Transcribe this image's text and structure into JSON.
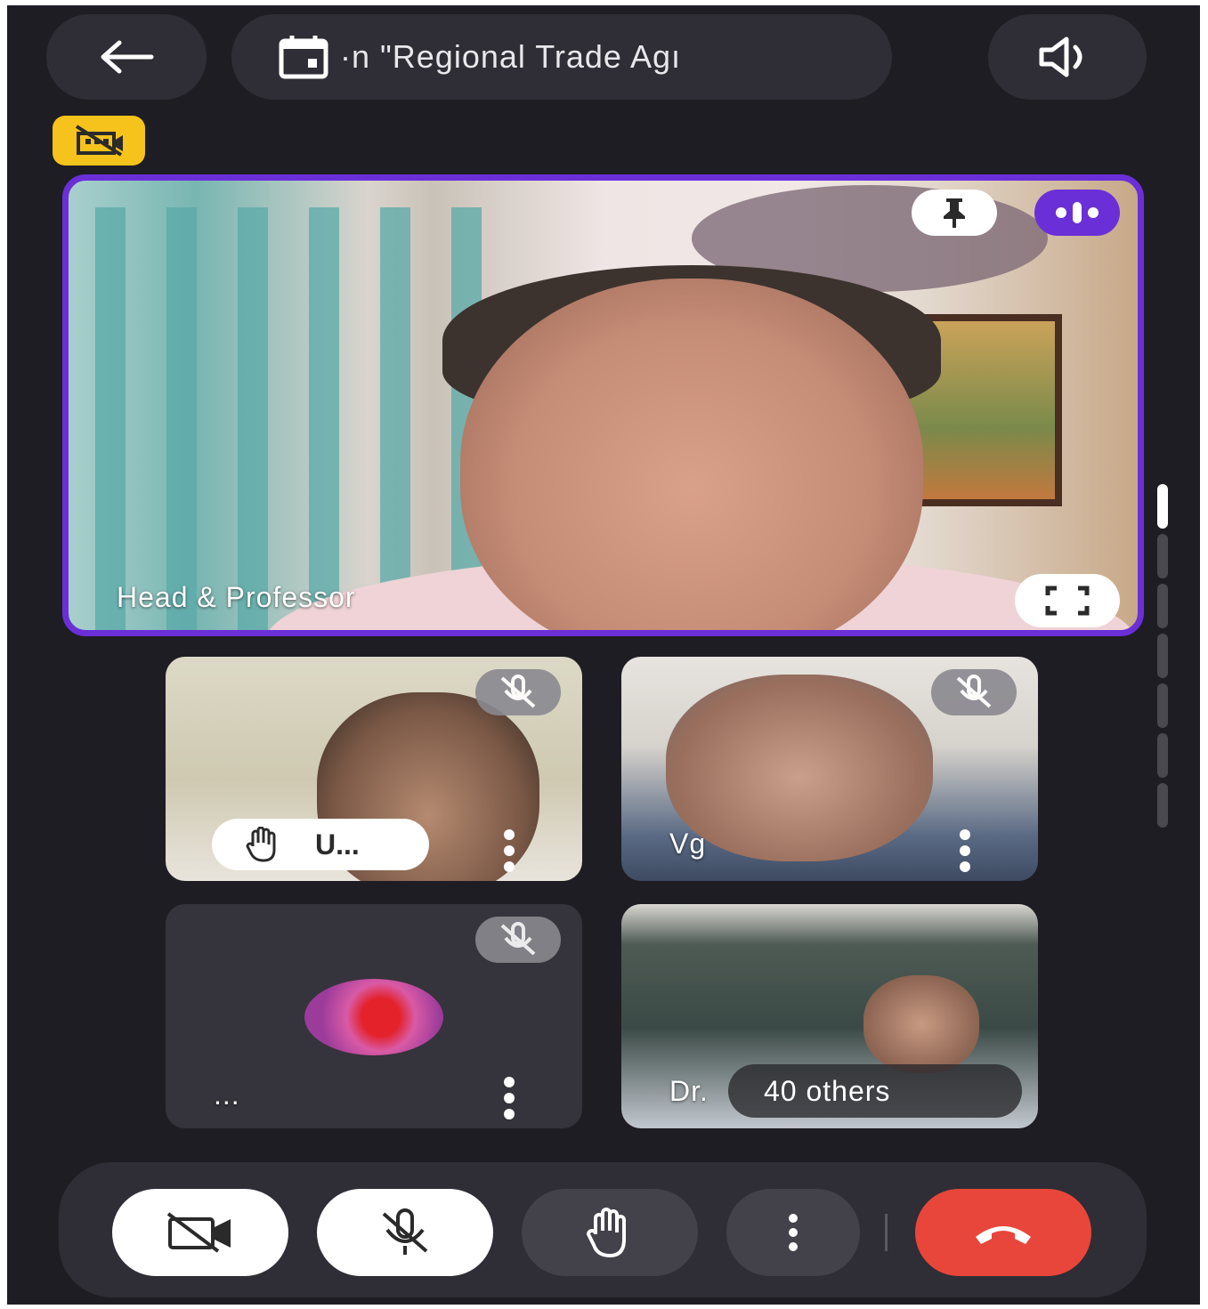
{
  "header": {
    "back_icon": "arrow-left-icon",
    "meeting_title": "·n \"Regional Trade Agı",
    "calendar_icon": "calendar-icon",
    "audio_icon": "speaker-icon"
  },
  "badge": {
    "icon": "video-off-building-icon",
    "color": "#f6c21c"
  },
  "main_tile": {
    "name": "Head & Professor",
    "pin_icon": "pin-icon",
    "speaking_icon": "speaking-indicator-icon",
    "fullscreen_icon": "fullscreen-icon",
    "highlight_color": "#6b2fd8"
  },
  "tiles": [
    {
      "label": "U...",
      "hand_raised": true,
      "muted": true
    },
    {
      "label": "Vg",
      "muted": true
    },
    {
      "label": "...",
      "muted": true
    },
    {
      "label": "Dr.",
      "overlay": "40 others"
    }
  ],
  "controls": {
    "camera_icon": "camera-off-icon",
    "mic_icon": "mic-off-icon",
    "hand_icon": "raise-hand-icon",
    "more_icon": "more-vertical-icon",
    "end_call_icon": "end-call-icon",
    "end_call_color": "#e8463a"
  }
}
